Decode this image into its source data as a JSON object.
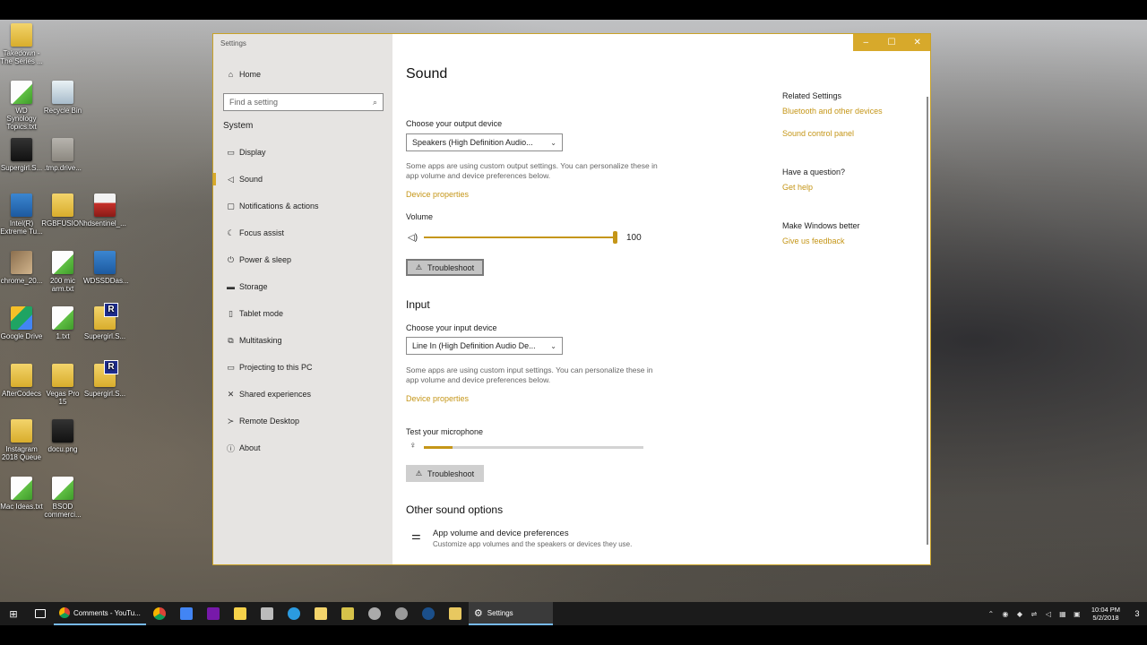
{
  "desktop": {
    "icons": [
      {
        "label": "Takedown - The Series ..."
      },
      {
        "label": "WD Synology Topics.txt"
      },
      {
        "label": "Recycle Bin"
      },
      {
        "label": "Supergirl.S..."
      },
      {
        "label": ".tmp.drive..."
      },
      {
        "label": "Intel(R) Extreme Tu..."
      },
      {
        "label": "RGBFUSION"
      },
      {
        "label": "hdsentinel_..."
      },
      {
        "label": "chrome_20..."
      },
      {
        "label": "200 mic arm.txt"
      },
      {
        "label": "WDSSDDas..."
      },
      {
        "label": "Google Drive"
      },
      {
        "label": "1.txt"
      },
      {
        "label": "Supergirl.S..."
      },
      {
        "label": "AfterCodecs"
      },
      {
        "label": "Vegas Pro 15"
      },
      {
        "label": "Supergirl.S..."
      },
      {
        "label": "Instagram 2018 Queue"
      },
      {
        "label": "docu.png"
      },
      {
        "label": "Mac Ideas.txt"
      },
      {
        "label": "BSOD commerci..."
      }
    ]
  },
  "window": {
    "title": "Settings",
    "controls": {
      "minimize": "–",
      "maximize": "☐",
      "close": "✕"
    },
    "accent": "#d7a92b"
  },
  "sidebar": {
    "home": "Home",
    "search_placeholder": "Find a setting",
    "section": "System",
    "items": [
      {
        "label": "Display",
        "icon": "display-icon"
      },
      {
        "label": "Sound",
        "icon": "speaker-icon"
      },
      {
        "label": "Notifications & actions",
        "icon": "notification-icon"
      },
      {
        "label": "Focus assist",
        "icon": "moon-icon"
      },
      {
        "label": "Power & sleep",
        "icon": "power-icon"
      },
      {
        "label": "Storage",
        "icon": "storage-icon"
      },
      {
        "label": "Tablet mode",
        "icon": "tablet-icon"
      },
      {
        "label": "Multitasking",
        "icon": "multitasking-icon"
      },
      {
        "label": "Projecting to this PC",
        "icon": "projecting-icon"
      },
      {
        "label": "Shared experiences",
        "icon": "shared-icon"
      },
      {
        "label": "Remote Desktop",
        "icon": "remote-desktop-icon"
      },
      {
        "label": "About",
        "icon": "info-icon"
      }
    ],
    "active_item": "Sound"
  },
  "main": {
    "title": "Sound",
    "output": {
      "label": "Choose your output device",
      "selected": "Speakers (High Definition Audio...",
      "description": "Some apps are using custom output settings. You can personalize these in app volume and device preferences below.",
      "device_properties": "Device properties",
      "volume_label": "Volume",
      "volume_value": "100",
      "troubleshoot": "Troubleshoot"
    },
    "input": {
      "heading": "Input",
      "label": "Choose your input device",
      "selected": "Line In (High Definition Audio De...",
      "description": "Some apps are using custom input settings. You can personalize these in app volume and device preferences below.",
      "device_properties": "Device properties",
      "test_label": "Test your microphone",
      "mic_level": 0.13,
      "troubleshoot": "Troubleshoot"
    },
    "other": {
      "heading": "Other sound options",
      "item_title": "App volume and device preferences",
      "item_desc": "Customize app volumes and the speakers or devices they use."
    }
  },
  "related": {
    "heading": "Related Settings",
    "links": [
      "Bluetooth and other devices",
      "Sound control panel"
    ],
    "question_heading": "Have a question?",
    "get_help": "Get help",
    "better_heading": "Make Windows better",
    "feedback": "Give us feedback"
  },
  "taskbar": {
    "apps": [
      {
        "label": "Comments - YouTu...",
        "icon": "chrome-icon"
      },
      {
        "label": "Settings",
        "icon": "gear-icon"
      }
    ],
    "time": "10:04 PM",
    "date": "5/2/2018",
    "notification_count": "3"
  }
}
